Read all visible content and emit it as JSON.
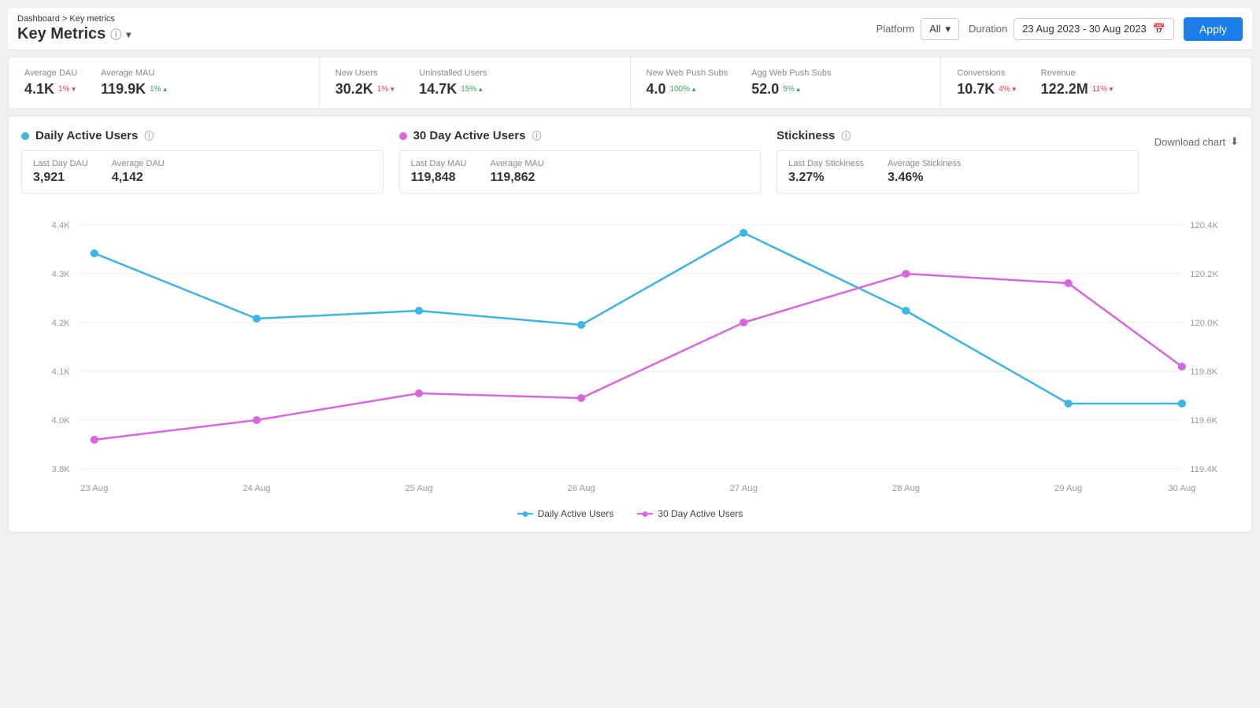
{
  "breadcrumb": {
    "parent": "Dashboard",
    "separator": ">",
    "current": "Key metrics"
  },
  "page_title": "Key Metrics",
  "header": {
    "platform_label": "Platform",
    "platform_value": "All",
    "duration_label": "Duration",
    "duration_value": "23 Aug 2023 - 30 Aug 2023",
    "apply_label": "Apply"
  },
  "metrics": [
    {
      "label": "Average DAU",
      "value": "4.1K",
      "badge": "1%",
      "direction": "down"
    },
    {
      "label": "Average MAU",
      "value": "119.9K",
      "badge": "1%",
      "direction": "up"
    },
    {
      "label": "New Users",
      "value": "30.2K",
      "badge": "1%",
      "direction": "down"
    },
    {
      "label": "Uninstalled Users",
      "value": "14.7K",
      "badge": "15%",
      "direction": "up"
    },
    {
      "label": "New Web Push Subs",
      "value": "4.0",
      "badge": "100%",
      "direction": "up"
    },
    {
      "label": "Agg Web Push Subs",
      "value": "52.0",
      "badge": "5%",
      "direction": "up"
    },
    {
      "label": "Conversions",
      "value": "10.7K",
      "badge": "4%",
      "direction": "down"
    },
    {
      "label": "Revenue",
      "value": "122.2M",
      "badge": "11%",
      "direction": "down"
    }
  ],
  "sections": {
    "dau": {
      "title": "Daily Active Users",
      "last_day_label": "Last Day DAU",
      "last_day_value": "3,921",
      "average_label": "Average DAU",
      "average_value": "4,142"
    },
    "mau": {
      "title": "30 Day Active Users",
      "last_day_label": "Last Day MAU",
      "last_day_value": "119,848",
      "average_label": "Average MAU",
      "average_value": "119,862"
    },
    "stickiness": {
      "title": "Stickiness",
      "last_day_label": "Last Day Stickiness",
      "last_day_value": "3.27%",
      "average_label": "Average Stickiness",
      "average_value": "3.46%"
    },
    "download_chart": "Download chart"
  },
  "chart": {
    "x_labels": [
      "23 Aug",
      "24 Aug",
      "25 Aug",
      "26 Aug",
      "27 Aug",
      "28 Aug",
      "29 Aug",
      "30 Aug"
    ],
    "y_left_labels": [
      "3.8K",
      "4.0K",
      "4.1K",
      "4.2K",
      "4.3K",
      "4.4K"
    ],
    "y_right_labels": [
      "119.4K",
      "119.6K",
      "119.8K",
      "120.0K",
      "120.2K",
      "120.4K"
    ],
    "dau_points": [
      4330,
      4170,
      4190,
      4155,
      4380,
      4190,
      3960,
      3960
    ],
    "mau_points": [
      119520,
      119600,
      119710,
      119690,
      120000,
      120200,
      120160,
      119820
    ],
    "legend": {
      "dau": "Daily Active Users",
      "mau": "30 Day Active Users"
    }
  }
}
